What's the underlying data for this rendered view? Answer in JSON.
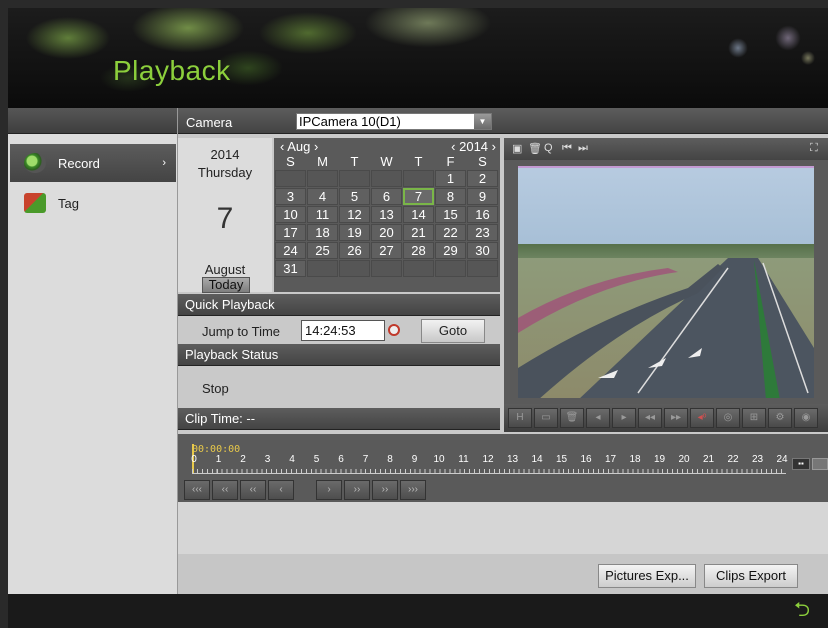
{
  "header": {
    "title": "Playback"
  },
  "sidebar": {
    "items": [
      {
        "label": "Record",
        "icon": "record-icon",
        "active": true
      },
      {
        "label": "Tag",
        "icon": "tag-icon",
        "active": false
      }
    ]
  },
  "camera": {
    "label": "Camera",
    "selected": "IPCamera 10(D1)"
  },
  "date": {
    "year": "2014",
    "weekday": "Thursday",
    "day": "7",
    "month": "August",
    "today_label": "Today"
  },
  "calendar": {
    "month": "Aug",
    "year": "2014",
    "days_of_week": [
      "S",
      "M",
      "T",
      "W",
      "T",
      "F",
      "S"
    ],
    "weeks": [
      [
        "",
        "",
        "",
        "",
        "",
        "1",
        "2"
      ],
      [
        "3",
        "4",
        "5",
        "6",
        "7",
        "8",
        "9"
      ],
      [
        "10",
        "11",
        "12",
        "13",
        "14",
        "15",
        "16"
      ],
      [
        "17",
        "18",
        "19",
        "20",
        "21",
        "22",
        "23"
      ],
      [
        "24",
        "25",
        "26",
        "27",
        "28",
        "29",
        "30"
      ],
      [
        "31",
        "",
        "",
        "",
        "",
        "",
        ""
      ]
    ],
    "selected": "7"
  },
  "quick_playback": {
    "title": "Quick Playback",
    "jump_label": "Jump to Time",
    "time_value": "14:24:53",
    "goto_label": "Goto"
  },
  "playback_status": {
    "title": "Playback Status",
    "status": "Stop"
  },
  "clip": {
    "label": "Clip Time: --"
  },
  "timeline": {
    "current_time": "00:00:00",
    "ticks": [
      "0",
      "1",
      "2",
      "3",
      "4",
      "5",
      "6",
      "7",
      "8",
      "9",
      "10",
      "11",
      "12",
      "13",
      "14",
      "15",
      "16",
      "17",
      "18",
      "19",
      "20",
      "21",
      "22",
      "23",
      "24"
    ]
  },
  "nav_buttons": [
    "‹‹‹",
    "‹‹",
    "‹‹",
    "‹",
    "›",
    "››",
    "››",
    "›››"
  ],
  "export": {
    "pictures_label": "Pictures Exp...",
    "clips_label": "Clips Export"
  },
  "colors": {
    "accent": "#8ccf3c",
    "selected_day": "#7ab648",
    "time_marker": "#e8c94a"
  }
}
